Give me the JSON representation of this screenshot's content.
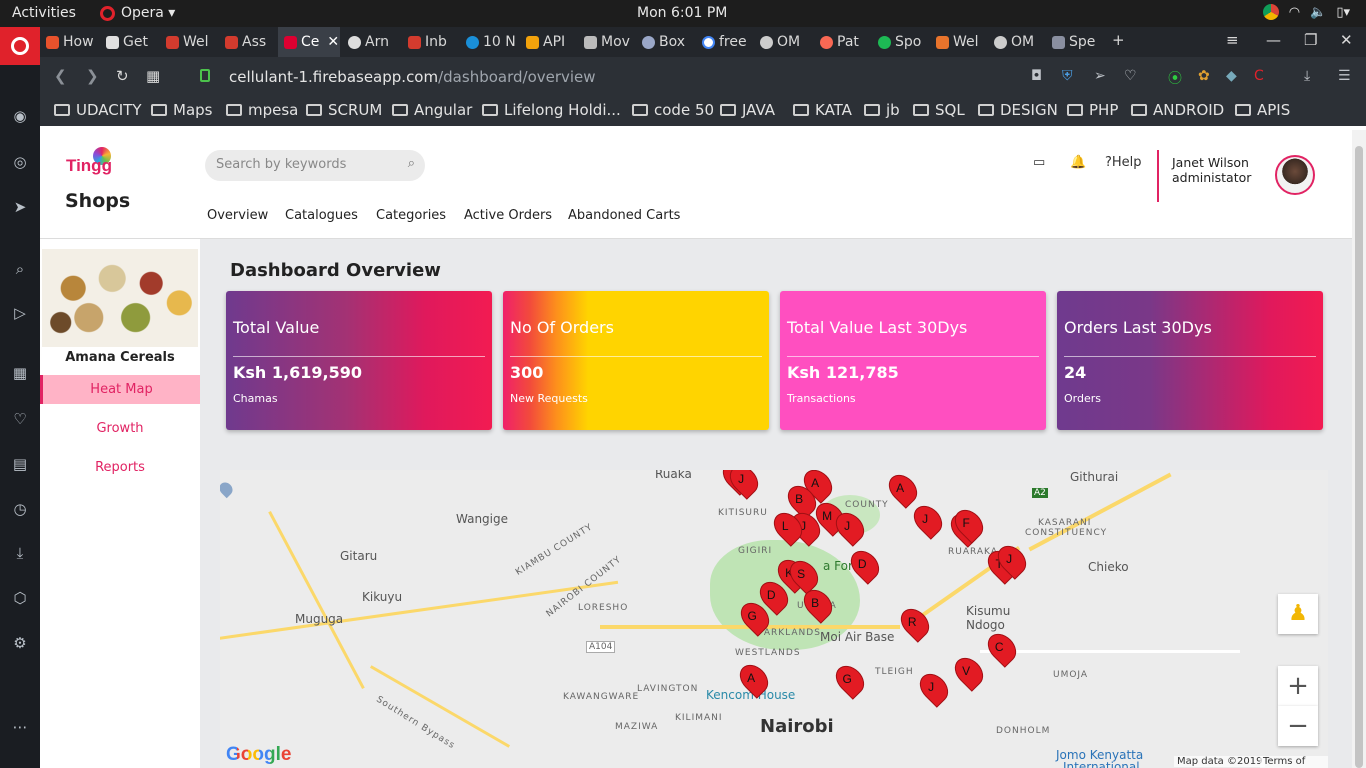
{
  "os": {
    "activities": "Activities",
    "app": "Opera ▾",
    "clock": "Mon  6:01 PM"
  },
  "tabs": [
    "How",
    "Get",
    "Wel",
    "Ass",
    "Ce",
    "Arn",
    "Inb",
    "10 N",
    "API",
    "Mov",
    "Box",
    "free",
    "OM",
    "Pat",
    "Spo",
    "Wel",
    "OM",
    "Spe"
  ],
  "address": {
    "host": "cellulant-1.firebaseapp.com",
    "path": "/dashboard/overview"
  },
  "bookmarks": [
    "UDACITY",
    "Maps",
    "mpesa",
    "SCRUM",
    "Angular",
    "Lifelong Holdi...",
    "code 50",
    "JAVA",
    "KATA",
    "jb",
    "SQL",
    "DESIGN",
    "PHP",
    "ANDROID",
    "APIS"
  ],
  "header": {
    "brand": "Tingg",
    "shops": "Shops",
    "search_placeholder": "Search by keywords",
    "help": "Help",
    "user_name": "Janet Wilson",
    "user_role": "administator",
    "nav": [
      "Overview",
      "Catalogues",
      "Categories",
      "Active Orders",
      "Abandoned Carts"
    ]
  },
  "store": {
    "name": "Amana Cereals",
    "menu": [
      "Heat Map",
      "Growth",
      "Reports"
    ]
  },
  "dashboard": {
    "title": "Dashboard Overview",
    "cards": [
      {
        "title": "Total Value",
        "value": "Ksh 1,619,590",
        "sub": "Chamas"
      },
      {
        "title": "No Of Orders",
        "value": "300",
        "sub": "New Requests"
      },
      {
        "title": "Total Value Last 30Dys",
        "value": "Ksh 121,785",
        "sub": "Transactions"
      },
      {
        "title": "Orders Last 30Dys",
        "value": "24",
        "sub": "Orders"
      }
    ]
  },
  "map": {
    "labels": [
      "Ruaka",
      "Githurai",
      "Wangige",
      "Gitaru",
      "Kikuyu",
      "Muguga",
      "Chieko",
      "Kisumu",
      "Ndogo",
      "Moi Air Base",
      "Kencom House",
      "Nairobi",
      "Jomo Kenyatta",
      "International"
    ],
    "small_labels": [
      "KITISURU",
      "KIAMBU COUNTY",
      "NAIROBI COUNTY",
      "LORESHO",
      "GIGIRI",
      "PARKLANDS",
      "WESTLANDS",
      "KAWANGWARE",
      "LAVINGTON",
      "KILIMANI",
      "MAZIWA",
      "KASARANI",
      "CONSTITUENCY",
      "RUARAKA",
      "UMOJA",
      "DONHOLM",
      "A104",
      "A2",
      "Southern Bypass",
      "a Fores",
      "UTHAIA",
      "COUNTY",
      "TLEIGH"
    ],
    "pins": [
      "A",
      "B",
      "J",
      "M",
      "J",
      "J",
      "A",
      "J",
      "C",
      "D",
      "K",
      "S",
      "D",
      "G",
      "B",
      "R",
      "C",
      "T",
      "J",
      "A",
      "G",
      "V",
      "J",
      "L",
      "J",
      "F"
    ],
    "zoom_in": "+",
    "zoom_out": "−",
    "google": "Google",
    "attribution": "Map data ©2019",
    "terms": "Terms of Use"
  }
}
